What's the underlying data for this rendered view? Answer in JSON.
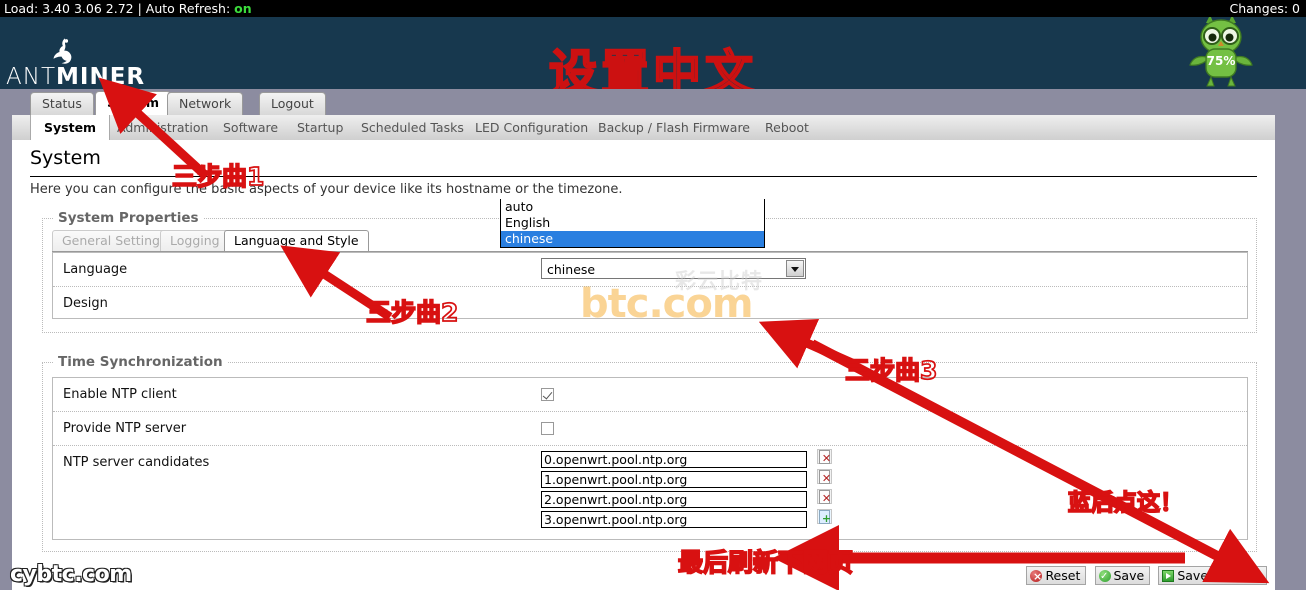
{
  "topbar": {
    "load_text": "Load: 3.40 3.06 2.72 | Auto Refresh:",
    "refresh_state": "on",
    "changes": "Changes: 0"
  },
  "header": {
    "brand_thin": "ANT",
    "brand_bold": "MINER",
    "cn_title": "设置中文",
    "owl_badge": "75%"
  },
  "main_tabs": [
    {
      "label": "Status",
      "active": false
    },
    {
      "label": "System",
      "active": true
    },
    {
      "label": "Network",
      "active": false
    },
    {
      "label": "Logout",
      "active": false
    }
  ],
  "sub_tabs": [
    {
      "label": "System",
      "active": true
    },
    {
      "label": "Administration",
      "active": false
    },
    {
      "label": "Software",
      "active": false
    },
    {
      "label": "Startup",
      "active": false
    },
    {
      "label": "Scheduled Tasks",
      "active": false
    },
    {
      "label": "LED Configuration",
      "active": false
    },
    {
      "label": "Backup / Flash Firmware",
      "active": false
    },
    {
      "label": "Reboot",
      "active": false
    }
  ],
  "page": {
    "title": "System",
    "intro": "Here you can configure the basic aspects of your device like its hostname or the timezone."
  },
  "system_properties": {
    "legend": "System Properties",
    "tabs": [
      {
        "label": "General Settings",
        "active": false
      },
      {
        "label": "Logging",
        "active": false
      },
      {
        "label": "Language and Style",
        "active": true
      }
    ],
    "rows": [
      {
        "label": "Language"
      },
      {
        "label": "Design"
      }
    ],
    "language_select": {
      "value": "chinese",
      "options": [
        {
          "label": "auto",
          "selected": false
        },
        {
          "label": "English",
          "selected": false
        },
        {
          "label": "chinese",
          "selected": true
        }
      ]
    }
  },
  "time_sync": {
    "legend": "Time Synchronization",
    "enable_ntp_label": "Enable NTP client",
    "enable_ntp_checked": true,
    "provide_ntp_label": "Provide NTP server",
    "provide_ntp_checked": false,
    "candidates_label": "NTP server candidates",
    "candidates": [
      {
        "value": "0.openwrt.pool.ntp.org",
        "action": "remove"
      },
      {
        "value": "1.openwrt.pool.ntp.org",
        "action": "remove"
      },
      {
        "value": "2.openwrt.pool.ntp.org",
        "action": "remove"
      },
      {
        "value": "3.openwrt.pool.ntp.org",
        "action": "add"
      }
    ]
  },
  "buttons": {
    "reset": "Reset",
    "save": "Save",
    "save_apply": "Save & Apply"
  },
  "annotations": [
    {
      "text": "三步曲1"
    },
    {
      "text": "三步曲2"
    },
    {
      "text": "三步曲3"
    },
    {
      "text": "蓝后点这！"
    },
    {
      "text": "最后刷新下网页"
    }
  ],
  "watermarks": {
    "btc_text": "btc",
    "btc_suffix": ".com",
    "btc_cn": "彩云比特",
    "cybtc": "cybtc.com"
  },
  "colors": {
    "accent_red": "#d81111",
    "header_bg": "#17384e",
    "page_bg": "#8c8ca0",
    "select_highlight": "#2a7fe0",
    "status_on": "#3cdd3c"
  }
}
